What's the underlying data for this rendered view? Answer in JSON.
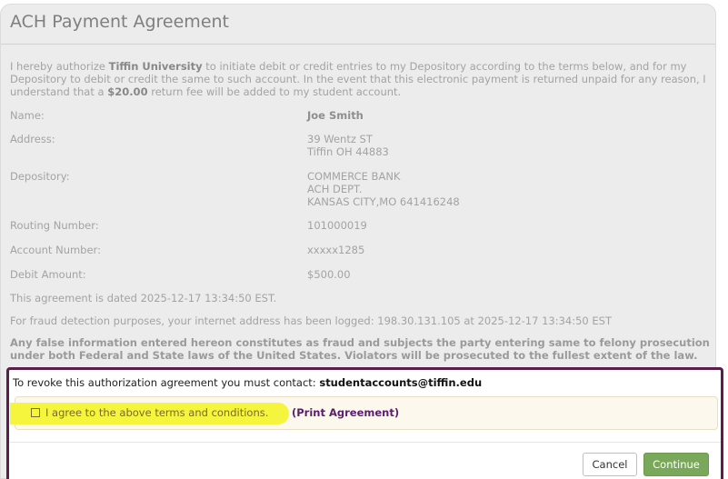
{
  "header": {
    "title": "ACH Payment Agreement"
  },
  "intro": {
    "p1": "I hereby authorize ",
    "org": "Tiffin University",
    "p2": " to initiate debit or credit entries to my Depository according to the terms below, and for my Depository to debit or credit the same to such account. In the event that this electronic payment is returned unpaid for any reason, I understand that a ",
    "fee": "$20.00",
    "p3": " return fee will be added to my student account."
  },
  "fields": {
    "name": {
      "label": "Name:",
      "value": "Joe Smith"
    },
    "address": {
      "label": "Address:",
      "line1": "39 Wentz ST",
      "line2": "Tiffin OH 44883"
    },
    "depository": {
      "label": "Depository:",
      "line1": "COMMERCE BANK",
      "line2": "ACH DEPT.",
      "line3": "KANSAS CITY,MO 641416248"
    },
    "routing": {
      "label": "Routing Number:",
      "value": "101000019"
    },
    "account": {
      "label": "Account Number:",
      "value": "xxxxx1285"
    },
    "debit": {
      "label": "Debit Amount:",
      "value": "$500.00"
    }
  },
  "notes": {
    "dated": "This agreement is dated 2025-12-17 13:34:50 EST.",
    "fraud": "For fraud detection purposes, your internet address has been logged: 198.30.131.105 at 2025-12-17 13:34:50 EST",
    "warning": "Any false information entered hereon constitutes as fraud and subjects the party entering same to felony prosecution under both Federal and State laws of the United States. Violators will be prosecuted to the fullest extent of the law."
  },
  "revoke": {
    "text": "To revoke this authorization agreement you must contact: ",
    "email": "studentaccounts@tiffin.edu"
  },
  "agree": {
    "label": "I agree to the above terms and conditions.",
    "print_link": "(Print Agreement)",
    "checked": false
  },
  "buttons": {
    "cancel": "Cancel",
    "continue": "Continue"
  },
  "colors": {
    "accent_border": "#5a1e4a",
    "continue_bg": "#7aa85a",
    "highlight": "#f4f53c"
  }
}
